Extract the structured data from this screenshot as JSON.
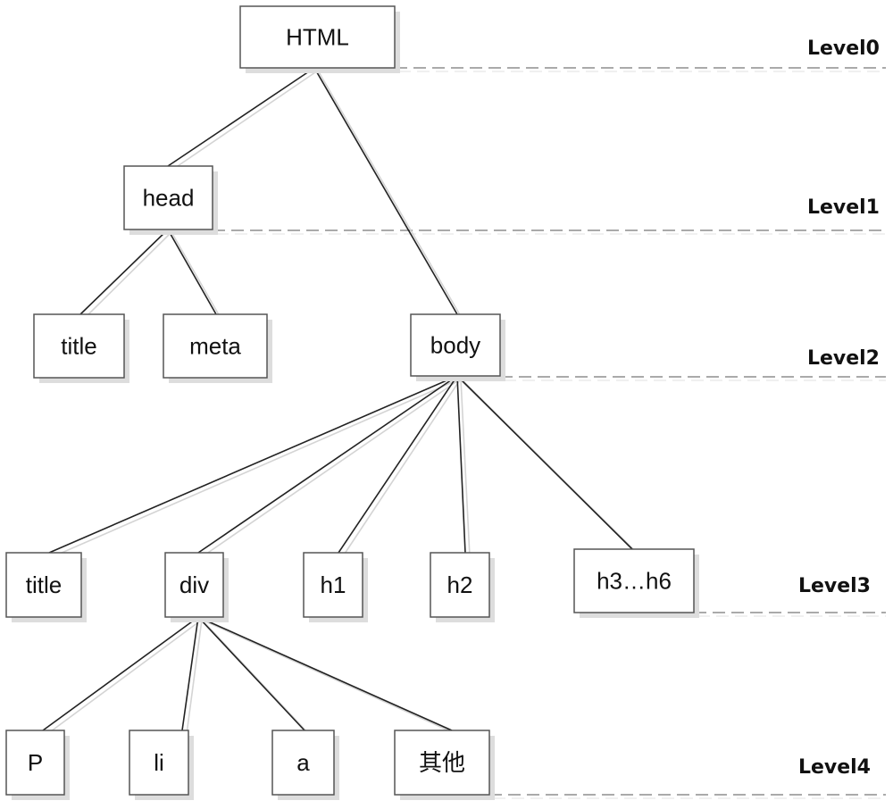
{
  "diagram": {
    "type": "tree",
    "levels": [
      {
        "id": "level0",
        "label": "Level0"
      },
      {
        "id": "level1",
        "label": "Level1"
      },
      {
        "id": "level2",
        "label": "Level2"
      },
      {
        "id": "level3",
        "label": "Level3"
      },
      {
        "id": "level4",
        "label": "Level4"
      }
    ],
    "nodes": [
      {
        "id": "html",
        "label": "HTML",
        "level": 0,
        "parent": null
      },
      {
        "id": "head",
        "label": "head",
        "level": 1,
        "parent": "html"
      },
      {
        "id": "title2",
        "label": "title",
        "level": 2,
        "parent": "head"
      },
      {
        "id": "meta",
        "label": "meta",
        "level": 2,
        "parent": "head"
      },
      {
        "id": "body",
        "label": "body",
        "level": 2,
        "parent": "html"
      },
      {
        "id": "title3",
        "label": "title",
        "level": 3,
        "parent": "body"
      },
      {
        "id": "div",
        "label": "div",
        "level": 3,
        "parent": "body"
      },
      {
        "id": "h1",
        "label": "h1",
        "level": 3,
        "parent": "body"
      },
      {
        "id": "h2",
        "label": "h2",
        "level": 3,
        "parent": "body"
      },
      {
        "id": "h3h6",
        "label": "h3…h6",
        "level": 3,
        "parent": "body"
      },
      {
        "id": "p",
        "label": "P",
        "level": 4,
        "parent": "div"
      },
      {
        "id": "li",
        "label": "li",
        "level": 4,
        "parent": "div"
      },
      {
        "id": "a",
        "label": "a",
        "level": 4,
        "parent": "div"
      },
      {
        "id": "other",
        "label": "其他",
        "level": 4,
        "parent": "div"
      }
    ],
    "colors": {
      "box_border": "#555555",
      "box_shadow": "#dddddd",
      "edge": "#222222",
      "edge_shadow": "#d4d4d4",
      "dash": "#777777"
    }
  }
}
